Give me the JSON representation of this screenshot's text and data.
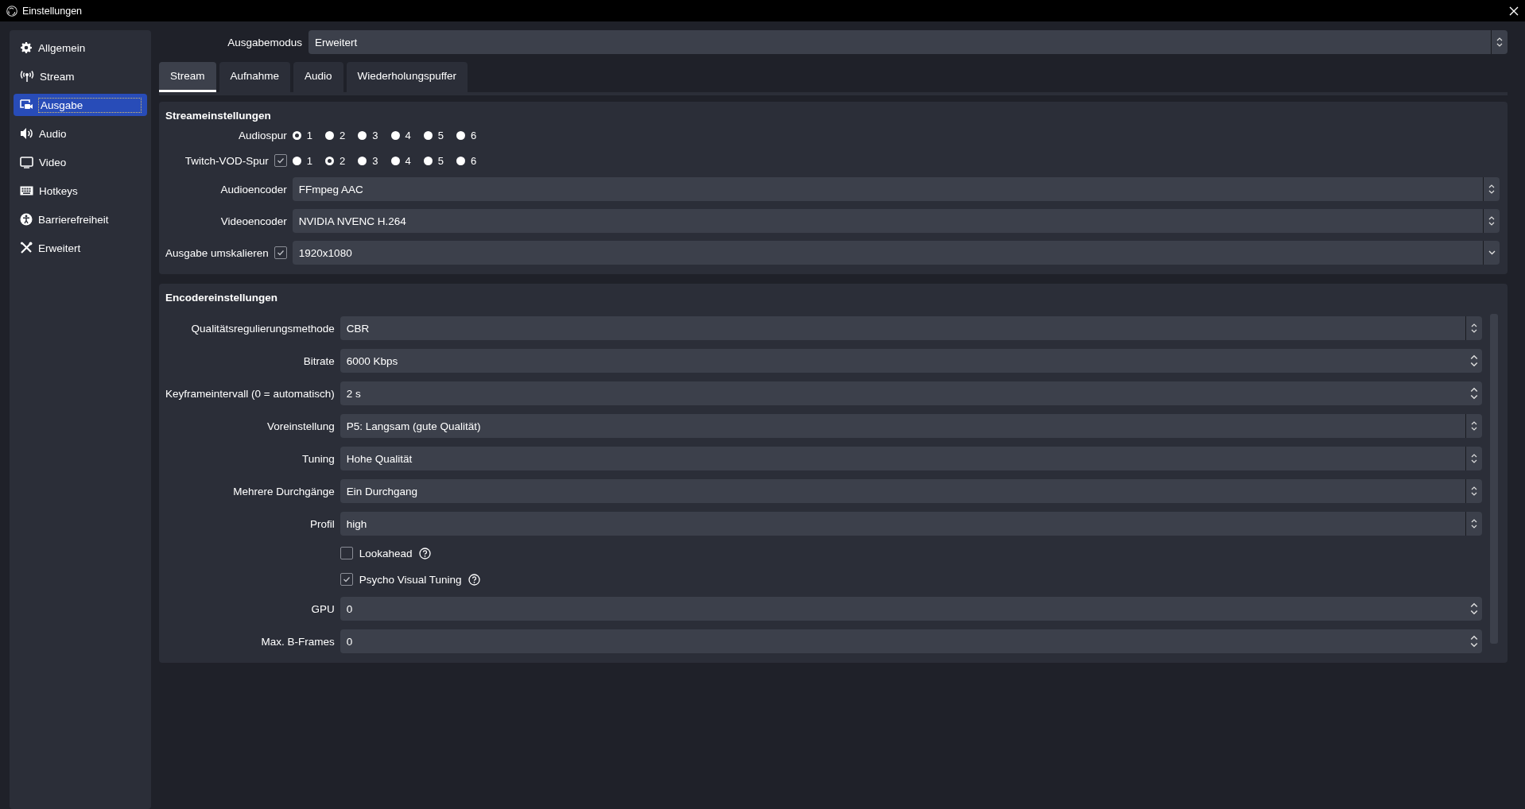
{
  "window": {
    "title": "Einstellungen"
  },
  "sidebar": {
    "items": [
      {
        "label": "Allgemein",
        "selected": false
      },
      {
        "label": "Stream",
        "selected": false
      },
      {
        "label": "Ausgabe",
        "selected": true
      },
      {
        "label": "Audio",
        "selected": false
      },
      {
        "label": "Video",
        "selected": false
      },
      {
        "label": "Hotkeys",
        "selected": false
      },
      {
        "label": "Barrierefreiheit",
        "selected": false
      },
      {
        "label": "Erweitert",
        "selected": false
      }
    ]
  },
  "output_mode": {
    "label": "Ausgabemodus",
    "value": "Erweitert"
  },
  "tabs": [
    {
      "label": "Stream",
      "selected": true
    },
    {
      "label": "Aufnahme",
      "selected": false
    },
    {
      "label": "Audio",
      "selected": false
    },
    {
      "label": "Wiederholungspuffer",
      "selected": false
    }
  ],
  "groups": [
    {
      "title": "Streameinstellungen",
      "rows": [
        {
          "kind": "radios",
          "label": "Audiospur",
          "options": [
            {
              "label": "1",
              "selected": true
            },
            {
              "label": "2",
              "selected": false
            },
            {
              "label": "3",
              "selected": false
            },
            {
              "label": "4",
              "selected": false
            },
            {
              "label": "5",
              "selected": false
            },
            {
              "label": "6",
              "selected": false
            }
          ]
        },
        {
          "kind": "radios",
          "label": "Twitch-VOD-Spur",
          "checked": true,
          "options": [
            {
              "label": "1",
              "selected": false
            },
            {
              "label": "2",
              "selected": true
            },
            {
              "label": "3",
              "selected": false
            },
            {
              "label": "4",
              "selected": false
            },
            {
              "label": "5",
              "selected": false
            },
            {
              "label": "6",
              "selected": false
            }
          ]
        },
        {
          "kind": "select",
          "label": "Audioencoder",
          "value": "FFmpeg AAC"
        },
        {
          "kind": "select",
          "label": "Videoencoder",
          "value": "NVIDIA NVENC H.264"
        },
        {
          "kind": "dropdown",
          "label": "Ausgabe umskalieren",
          "checked": true,
          "value": "1920x1080"
        }
      ]
    },
    {
      "title": "Encodereinstellungen",
      "rows": [
        {
          "kind": "select",
          "label": "Qualitätsregulierungsmethode",
          "value": "CBR"
        },
        {
          "kind": "spin",
          "label": "Bitrate",
          "value": "6000 Kbps"
        },
        {
          "kind": "spin",
          "label": "Keyframeintervall (0 = automatisch)",
          "value": "2 s"
        },
        {
          "kind": "select",
          "label": "Voreinstellung",
          "value": "P5: Langsam (gute Qualität)"
        },
        {
          "kind": "select",
          "label": "Tuning",
          "value": "Hohe Qualität"
        },
        {
          "kind": "select",
          "label": "Mehrere Durchgänge",
          "value": "Ein Durchgang"
        },
        {
          "kind": "select",
          "label": "Profil",
          "value": "high"
        },
        {
          "kind": "checkbox",
          "label": "Lookahead",
          "checked": false
        },
        {
          "kind": "checkbox",
          "label": "Psycho Visual Tuning",
          "checked": true
        },
        {
          "kind": "spin",
          "label": "GPU",
          "value": "0"
        },
        {
          "kind": "spin",
          "label": "Max. B-Frames",
          "value": "0"
        }
      ]
    }
  ]
}
